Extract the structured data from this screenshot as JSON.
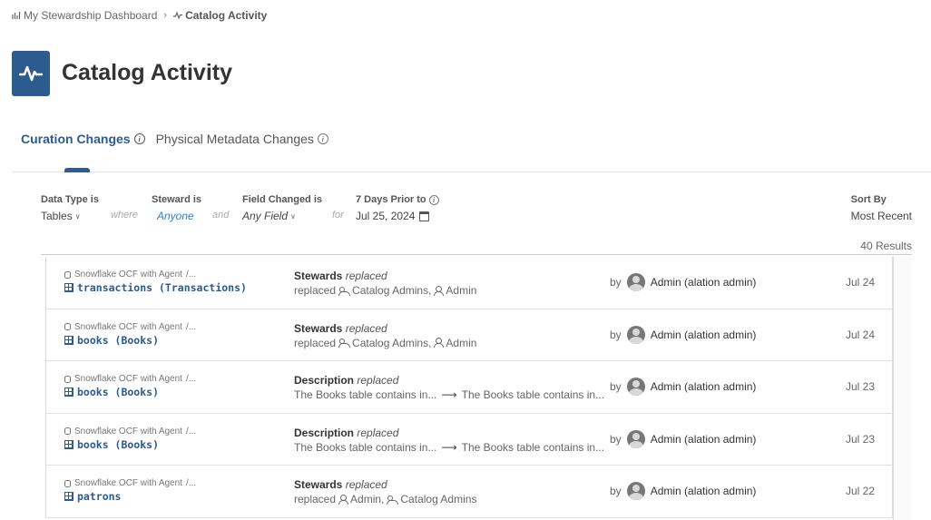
{
  "breadcrumb": {
    "parent": "My Stewardship Dashboard",
    "current": "Catalog Activity"
  },
  "page": {
    "title": "Catalog Activity"
  },
  "tabs": [
    {
      "label": "Curation Changes",
      "active": true
    },
    {
      "label": "Physical Metadata Changes",
      "active": false
    }
  ],
  "filters": {
    "data_type": {
      "label": "Data Type is",
      "value": "Tables"
    },
    "conj_where": "where",
    "steward": {
      "label": "Steward is",
      "value": "Anyone"
    },
    "conj_and": "and",
    "field": {
      "label": "Field Changed is",
      "value": "Any Field"
    },
    "conj_for": "for",
    "date": {
      "label": "7 Days Prior to",
      "value": "Jul 25, 2024"
    },
    "sort": {
      "label": "Sort By",
      "value": "Most Recent"
    }
  },
  "results": {
    "count_text": "40 Results"
  },
  "rows": [
    {
      "source": "Snowflake OCF with Agent",
      "source_sep": "/...",
      "table": "transactions (Transactions)",
      "field": "Stewards",
      "verb": "replaced",
      "detail_prefix": "replaced",
      "detail_a": "Catalog Admins,",
      "detail_b": "Admin",
      "by": "by",
      "user": "Admin (alation admin)",
      "date": "Jul 24"
    },
    {
      "source": "Snowflake OCF with Agent",
      "source_sep": "/...",
      "table": "books (Books)",
      "field": "Stewards",
      "verb": "replaced",
      "detail_prefix": "replaced",
      "detail_a": "Catalog Admins,",
      "detail_b": "Admin",
      "by": "by",
      "user": "Admin (alation admin)",
      "date": "Jul 24"
    },
    {
      "source": "Snowflake OCF with Agent",
      "source_sep": "/...",
      "table": "books (Books)",
      "field": "Description",
      "verb": "replaced",
      "detail_from": "The Books table contains in...",
      "detail_to": "The Books table contains in...",
      "by": "by",
      "user": "Admin (alation admin)",
      "date": "Jul 23"
    },
    {
      "source": "Snowflake OCF with Agent",
      "source_sep": "/...",
      "table": "books (Books)",
      "field": "Description",
      "verb": "replaced",
      "detail_from": "The Books table contains in...",
      "detail_to": "The Books table contains in...",
      "by": "by",
      "user": "Admin (alation admin)",
      "date": "Jul 23"
    },
    {
      "source": "Snowflake OCF with Agent",
      "source_sep": "/...",
      "table": "patrons",
      "field": "Stewards",
      "verb": "replaced",
      "detail_prefix": "replaced",
      "detail_a": "Admin,",
      "detail_b": "Catalog Admins",
      "by": "by",
      "user": "Admin (alation admin)",
      "date": "Jul 22"
    }
  ],
  "icons": {
    "breadcrumb_parent": "dashboard-icon",
    "breadcrumb_current": "activity-icon",
    "page_logo": "activity-icon",
    "info": "info-icon",
    "calendar": "calendar-icon",
    "source": "database-icon",
    "table": "table-icon",
    "user": "user-icon",
    "group": "group-icon",
    "avatar": "avatar"
  },
  "colors": {
    "brand": "#2c5b8f",
    "link": "#2c7fd1"
  }
}
